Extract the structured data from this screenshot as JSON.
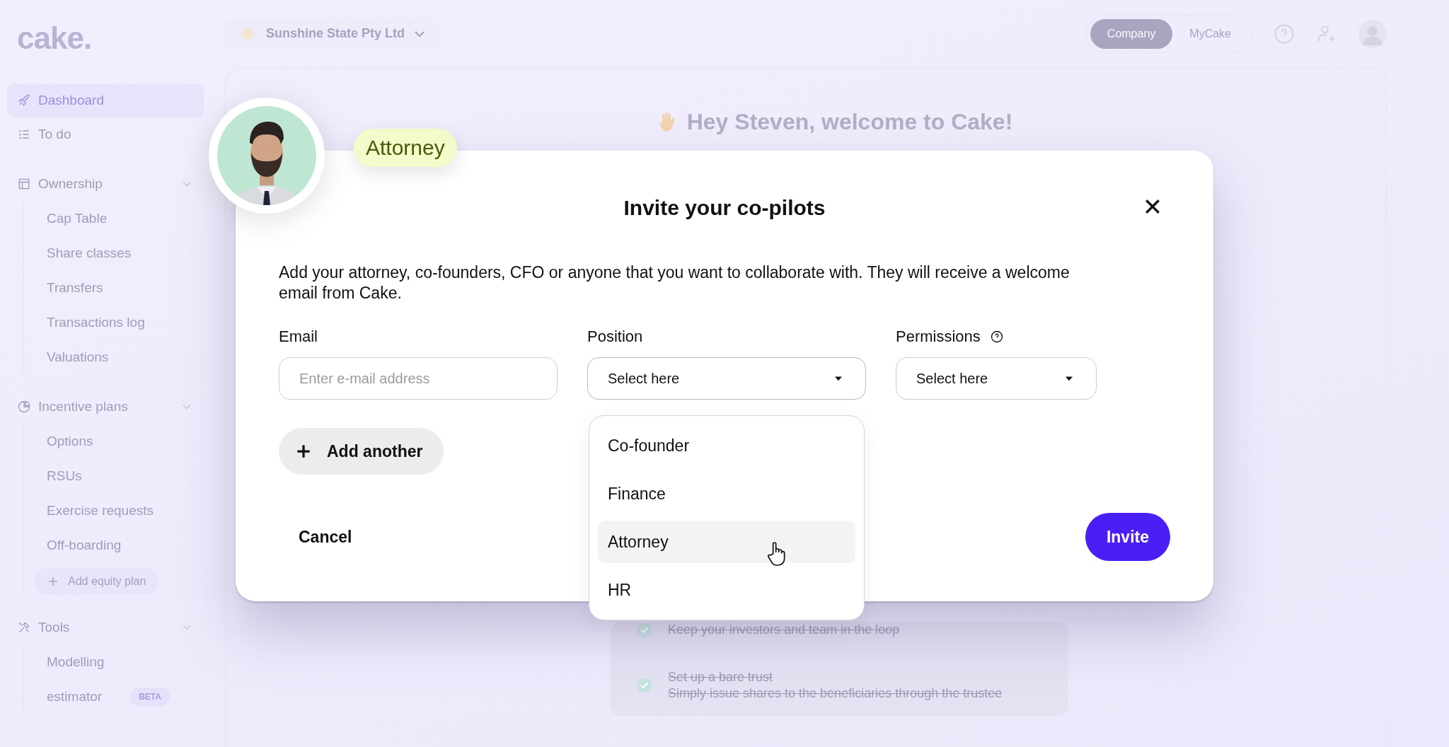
{
  "sidebar": {
    "logo": "cake.",
    "items": [
      {
        "label": "Dashboard",
        "selected": true
      },
      {
        "label": "To do",
        "selected": false
      },
      {
        "label": "Ownership",
        "selected": false,
        "expanded": true,
        "children": [
          {
            "label": "Cap Table",
            "selected": false
          },
          {
            "label": "Share classes",
            "selected": false
          },
          {
            "label": "Transfers",
            "selected": false
          },
          {
            "label": "Transactions log",
            "selected": false
          },
          {
            "label": "Valuations",
            "selected": false
          }
        ]
      },
      {
        "label": "Incentive plans",
        "selected": false,
        "expanded": true,
        "children": [
          {
            "label": "Options",
            "selected": false
          },
          {
            "label": "RSUs",
            "selected": false
          },
          {
            "label": "Exercise requests",
            "selected": false
          },
          {
            "label": "Off-boarding",
            "selected": false
          }
        ],
        "add_label": "Add equity plan"
      },
      {
        "label": "Tools",
        "selected": false,
        "expanded": true,
        "children": [
          {
            "label": "Modelling",
            "selected": false
          },
          {
            "label": "estimator",
            "selected": false,
            "badge": "BETA"
          }
        ]
      }
    ]
  },
  "top_bar": {
    "company": "Sunshine State Pty Ltd",
    "toggle": [
      {
        "label": "Company",
        "selected": true
      },
      {
        "label": "MyCake",
        "selected": false
      }
    ]
  },
  "main": {
    "greeting": "Hey Steven, welcome to Cake!",
    "checklist": [
      {
        "description": "Keep your investors and team in the loop",
        "done": true
      },
      {
        "title": "Set up a bare trust",
        "description": "Simply issue shares to the beneficiaries through the trustee",
        "done": true
      }
    ]
  },
  "invitee_preview": {
    "role_tag": "Attorney"
  },
  "modal": {
    "title": "Invite your co-pilots",
    "description": "Add your attorney, co-founders, CFO or anyone that you want to collaborate with. They will receive a welcome email from Cake.",
    "fields": [
      {
        "label": "Email",
        "kind": "text",
        "placeholder": "Enter e-mail address"
      },
      {
        "label": "Position",
        "kind": "select",
        "value": "Select here",
        "expanded": true,
        "options": [
          {
            "label": "Co-founder",
            "selected": false
          },
          {
            "label": "Finance",
            "selected": false
          },
          {
            "label": "Attorney",
            "selected": true
          },
          {
            "label": "HR",
            "selected": false
          }
        ]
      },
      {
        "label": "Permissions",
        "kind": "select",
        "value": "Select here",
        "help": true,
        "expanded": false
      }
    ],
    "add_button": "Add another",
    "cancel": "Cancel",
    "submit": "Invite"
  }
}
